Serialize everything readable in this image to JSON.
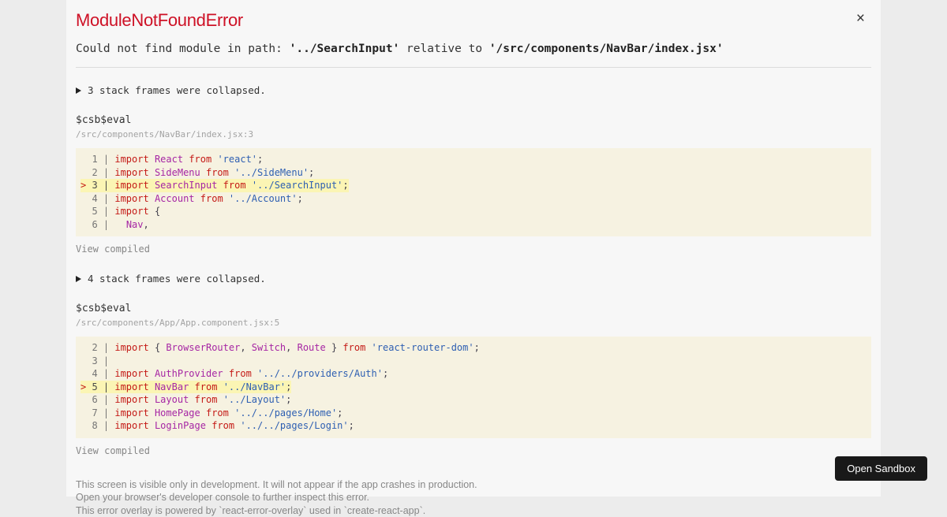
{
  "overlay": {
    "title": "ModuleNotFoundError",
    "close_glyph": "×",
    "message": {
      "prefix": "Could not find module in path: ",
      "module_path": "'../SearchInput'",
      "middle": " relative to ",
      "relative_file": "'/src/components/NavBar/index.jsx'"
    }
  },
  "colors": {
    "error_red": "#ce1126",
    "syntax_keyword": "#c41a16",
    "syntax_identifier": "#a626a4",
    "syntax_string": "#2e5fb2",
    "code_background": "#f6f2e1",
    "highlight_line": "#fbf5b4",
    "button_background": "#191919"
  },
  "frames": [
    {
      "collapsed_label": "3 stack frames were collapsed.",
      "function_name": "$csb$eval",
      "location": "/src/components/NavBar/index.jsx:3",
      "view_compiled_label": "View compiled",
      "code": {
        "lines": [
          {
            "no": "1",
            "marker": "",
            "highlight": false,
            "tokens": [
              [
                "kw",
                "import"
              ],
              [
                "pln",
                " "
              ],
              [
                "cls",
                "React"
              ],
              [
                "pln",
                " "
              ],
              [
                "kw",
                "from"
              ],
              [
                "pln",
                " "
              ],
              [
                "str",
                "'react'"
              ],
              [
                "pln",
                ";"
              ]
            ]
          },
          {
            "no": "2",
            "marker": "",
            "highlight": false,
            "tokens": [
              [
                "kw",
                "import"
              ],
              [
                "pln",
                " "
              ],
              [
                "cls",
                "SideMenu"
              ],
              [
                "pln",
                " "
              ],
              [
                "kw",
                "from"
              ],
              [
                "pln",
                " "
              ],
              [
                "str",
                "'../SideMenu'"
              ],
              [
                "pln",
                ";"
              ]
            ]
          },
          {
            "no": "3",
            "marker": ">",
            "highlight": true,
            "tokens": [
              [
                "kw",
                "import"
              ],
              [
                "pln",
                " "
              ],
              [
                "cls",
                "SearchInput"
              ],
              [
                "pln",
                " "
              ],
              [
                "kw",
                "from"
              ],
              [
                "pln",
                " "
              ],
              [
                "str",
                "'../SearchInput'"
              ],
              [
                "pln",
                ";"
              ]
            ]
          },
          {
            "no": "4",
            "marker": "",
            "highlight": false,
            "tokens": [
              [
                "kw",
                "import"
              ],
              [
                "pln",
                " "
              ],
              [
                "cls",
                "Account"
              ],
              [
                "pln",
                " "
              ],
              [
                "kw",
                "from"
              ],
              [
                "pln",
                " "
              ],
              [
                "str",
                "'../Account'"
              ],
              [
                "pln",
                ";"
              ]
            ]
          },
          {
            "no": "5",
            "marker": "",
            "highlight": false,
            "tokens": [
              [
                "kw",
                "import"
              ],
              [
                "pln",
                " {"
              ]
            ]
          },
          {
            "no": "6",
            "marker": "",
            "highlight": false,
            "tokens": [
              [
                "pln",
                "  "
              ],
              [
                "cls",
                "Nav"
              ],
              [
                "pln",
                ","
              ]
            ]
          }
        ]
      }
    },
    {
      "collapsed_label": "4 stack frames were collapsed.",
      "function_name": "$csb$eval",
      "location": "/src/components/App/App.component.jsx:5",
      "view_compiled_label": "View compiled",
      "code": {
        "lines": [
          {
            "no": "2",
            "marker": "",
            "highlight": false,
            "tokens": [
              [
                "kw",
                "import"
              ],
              [
                "pln",
                " { "
              ],
              [
                "cls",
                "BrowserRouter"
              ],
              [
                "pln",
                ", "
              ],
              [
                "cls",
                "Switch"
              ],
              [
                "pln",
                ", "
              ],
              [
                "cls",
                "Route"
              ],
              [
                "pln",
                " } "
              ],
              [
                "kw",
                "from"
              ],
              [
                "pln",
                " "
              ],
              [
                "str",
                "'react-router-dom'"
              ],
              [
                "pln",
                ";"
              ]
            ]
          },
          {
            "no": "3",
            "marker": "",
            "highlight": false,
            "tokens": []
          },
          {
            "no": "4",
            "marker": "",
            "highlight": false,
            "tokens": [
              [
                "kw",
                "import"
              ],
              [
                "pln",
                " "
              ],
              [
                "cls",
                "AuthProvider"
              ],
              [
                "pln",
                " "
              ],
              [
                "kw",
                "from"
              ],
              [
                "pln",
                " "
              ],
              [
                "str",
                "'../../providers/Auth'"
              ],
              [
                "pln",
                ";"
              ]
            ]
          },
          {
            "no": "5",
            "marker": ">",
            "highlight": true,
            "tokens": [
              [
                "kw",
                "import"
              ],
              [
                "pln",
                " "
              ],
              [
                "cls",
                "NavBar"
              ],
              [
                "pln",
                " "
              ],
              [
                "kw",
                "from"
              ],
              [
                "pln",
                " "
              ],
              [
                "str",
                "'../NavBar'"
              ],
              [
                "pln",
                ";"
              ]
            ]
          },
          {
            "no": "6",
            "marker": "",
            "highlight": false,
            "tokens": [
              [
                "kw",
                "import"
              ],
              [
                "pln",
                " "
              ],
              [
                "cls",
                "Layout"
              ],
              [
                "pln",
                " "
              ],
              [
                "kw",
                "from"
              ],
              [
                "pln",
                " "
              ],
              [
                "str",
                "'../Layout'"
              ],
              [
                "pln",
                ";"
              ]
            ]
          },
          {
            "no": "7",
            "marker": "",
            "highlight": false,
            "tokens": [
              [
                "kw",
                "import"
              ],
              [
                "pln",
                " "
              ],
              [
                "cls",
                "HomePage"
              ],
              [
                "pln",
                " "
              ],
              [
                "kw",
                "from"
              ],
              [
                "pln",
                " "
              ],
              [
                "str",
                "'../../pages/Home'"
              ],
              [
                "pln",
                ";"
              ]
            ]
          },
          {
            "no": "8",
            "marker": "",
            "highlight": false,
            "tokens": [
              [
                "kw",
                "import"
              ],
              [
                "pln",
                " "
              ],
              [
                "cls",
                "LoginPage"
              ],
              [
                "pln",
                " "
              ],
              [
                "kw",
                "from"
              ],
              [
                "pln",
                " "
              ],
              [
                "str",
                "'../../pages/Login'"
              ],
              [
                "pln",
                ";"
              ]
            ]
          }
        ]
      }
    }
  ],
  "footer": {
    "line1": "This screen is visible only in development. It will not appear if the app crashes in production.",
    "line2": "Open your browser's developer console to further inspect this error.",
    "line3": "This error overlay is powered by `react-error-overlay` used in `create-react-app`."
  },
  "open_sandbox_label": "Open Sandbox"
}
